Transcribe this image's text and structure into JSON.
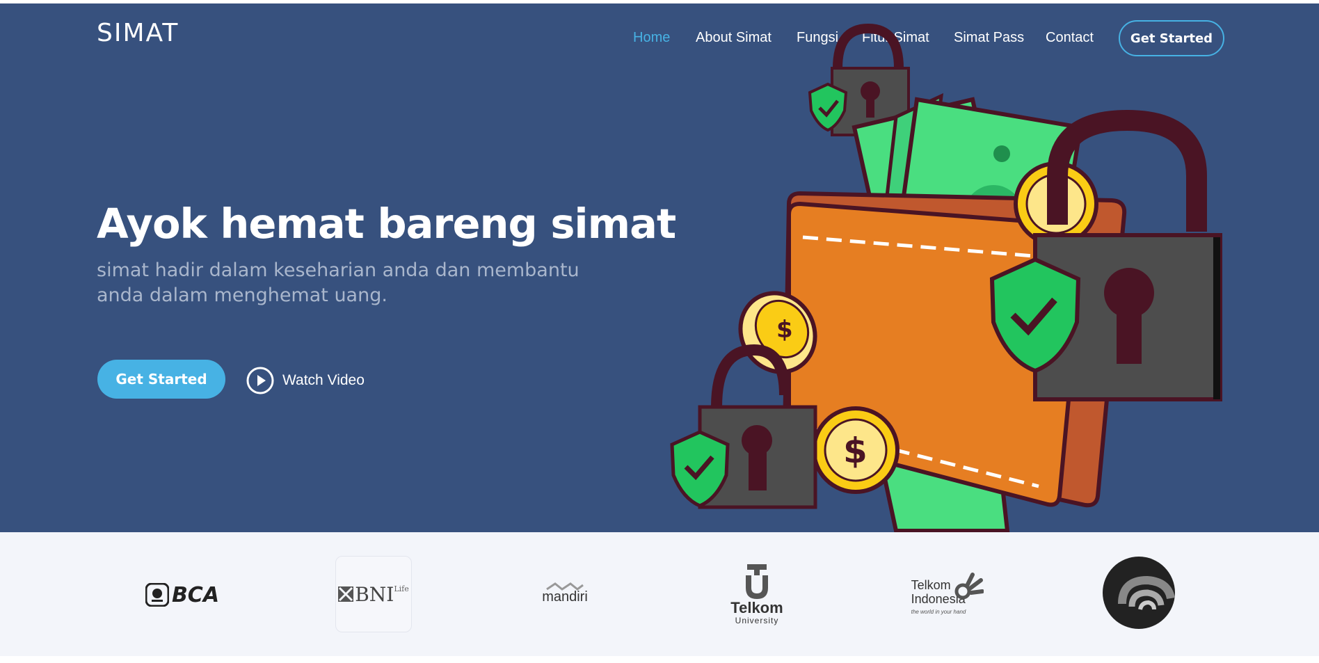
{
  "brand": {
    "name": "SIMAT"
  },
  "nav": {
    "items": [
      {
        "label": "Home",
        "active": true
      },
      {
        "label": "About Simat"
      },
      {
        "label": "Fungsi"
      },
      {
        "label": "Fitur Simat"
      },
      {
        "label": "Simat Pass"
      },
      {
        "label": "Contact"
      }
    ],
    "cta_label": "Get Started"
  },
  "hero": {
    "title": "Ayok hemat bareng simat",
    "subtitle": "simat hadir dalam keseharian anda dan membantu anda dalam menghemat uang.",
    "primary_button": "Get Started",
    "video_button": "Watch Video",
    "illustration": "wallet-money-locks-illustration"
  },
  "clients": {
    "logos": [
      {
        "name": "bca-logo",
        "text": "BCA"
      },
      {
        "name": "bni-life-logo",
        "text": "BNI",
        "sup": "Life"
      },
      {
        "name": "mandiri-logo",
        "text": "mandiri"
      },
      {
        "name": "telkom-university-logo",
        "text": "Telkom",
        "sub": "University"
      },
      {
        "name": "telkom-indonesia-logo",
        "text": "Telkom",
        "sub": "Indonesia",
        "tagline": "the world in your hand"
      },
      {
        "name": "kominfo-logo",
        "text": ""
      }
    ]
  },
  "colors": {
    "hero_bg": "#37517e",
    "accent": "#47b2e4",
    "clients_bg": "#f3f5fa"
  }
}
